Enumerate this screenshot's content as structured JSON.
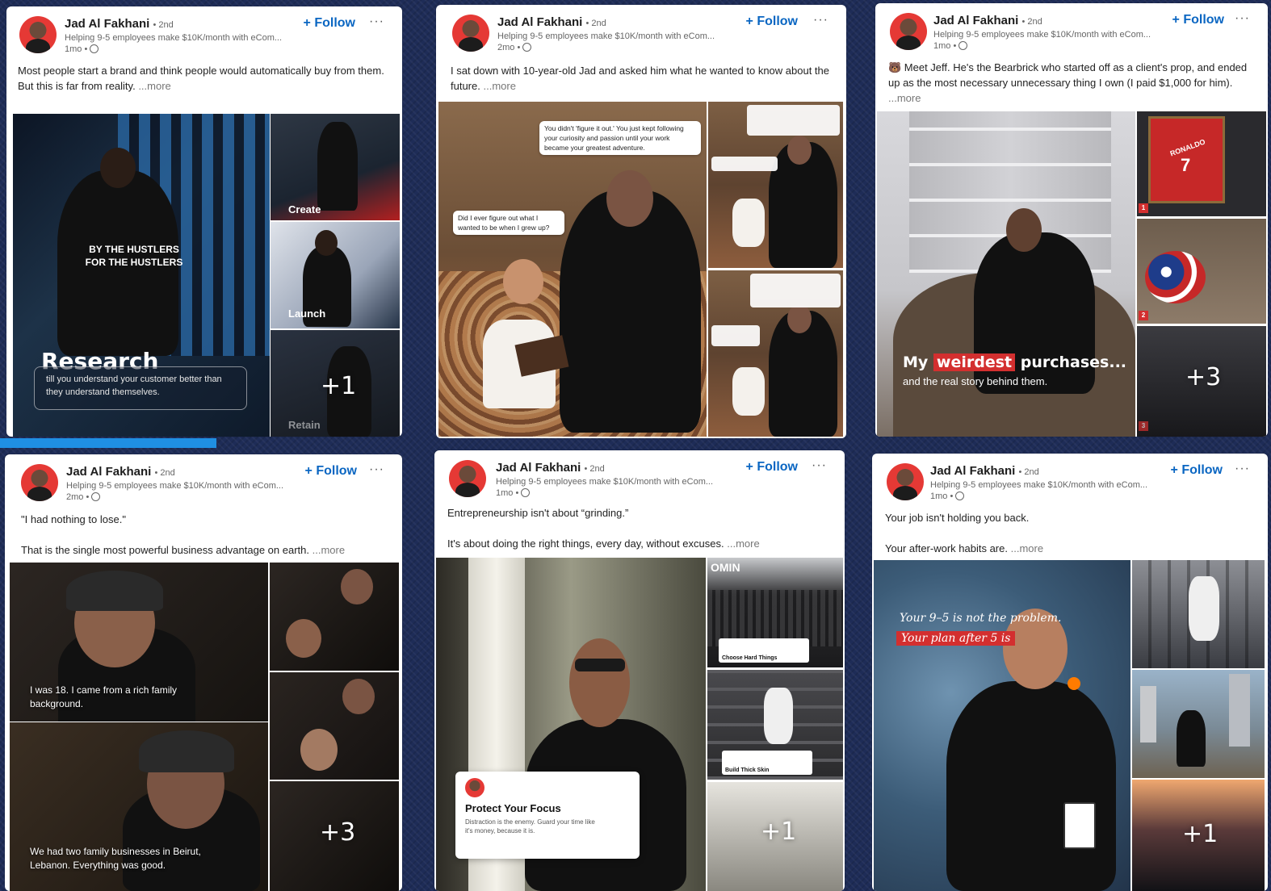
{
  "author": {
    "name": "Jad Al Fakhani",
    "degree": "• 2nd",
    "headline": "Helping 9-5 employees make $10K/month with eCom...",
    "follow_label": "Follow",
    "more_label": "...more"
  },
  "posts": [
    {
      "time": "1mo •",
      "text": [
        "Most people start a brand and think people would automatically buy from them.",
        "But this is far from reality."
      ],
      "media": {
        "main_title": "Research",
        "main_caption": "till you understand your customer better than they understand themselves.",
        "shirt_line1": "BY THE HUSTLERS",
        "shirt_line2": "FOR THE HUSTLERS",
        "tile_labels": [
          "Create",
          "Launch",
          "Retain"
        ],
        "extra_count": "+1"
      }
    },
    {
      "time": "2mo •",
      "text": [
        "I sat down with 10-year-old Jad and asked him what he wanted to know about the future."
      ],
      "media": {
        "bubble1": "You didn't 'figure it out.' You just kept following your curiosity and passion until your work became your greatest adventure.",
        "bubble2": "Did I ever figure out what I wanted to be when I grew up?"
      }
    },
    {
      "time": "1mo •",
      "text": [
        "🐻 Meet Jeff. He's the Bearbrick who started off as a client's prop, and ended up as the most necessary unnecessary thing I own (I paid $1,000 for him)."
      ],
      "media": {
        "title_pre": "My",
        "title_highlight": "weirdest",
        "title_post": "purchases...",
        "subtitle": "and the real story behind them.",
        "jersey": "RONALDO",
        "jersey_number": "7",
        "tags": [
          "1",
          "2",
          "3"
        ],
        "extra_count": "+3"
      }
    },
    {
      "time": "2mo •",
      "text": [
        "\"I had nothing to lose.\"",
        "",
        "That is the single most powerful business advantage on earth."
      ],
      "media": {
        "caption1": "I was 18. I came from a rich family background.",
        "caption2": "We had two family businesses in Beirut, Lebanon. Everything was good.",
        "extra_count": "+3"
      }
    },
    {
      "time": "1mo •",
      "text": [
        "Entrepreneurship isn't about “grinding.”",
        "",
        "It's about doing the right things, every day, without excuses."
      ],
      "media": {
        "tweet_title": "Protect Your Focus",
        "tweet_body": "Distraction is the enemy. Guard your time like it's money, because it is.",
        "tile_tags": [
          "Choose Hard Things",
          "Build Thick Skin"
        ],
        "banner_text": "OMIN",
        "extra_count": "+1"
      }
    },
    {
      "time": "1mo •",
      "text": [
        "Your job isn't holding you back.",
        "",
        "Your after-work habits are."
      ],
      "media": {
        "line1": "Your 9–5 is not the problem.",
        "line2": "Your plan after 5 is",
        "extra_count": "+1"
      }
    }
  ]
}
